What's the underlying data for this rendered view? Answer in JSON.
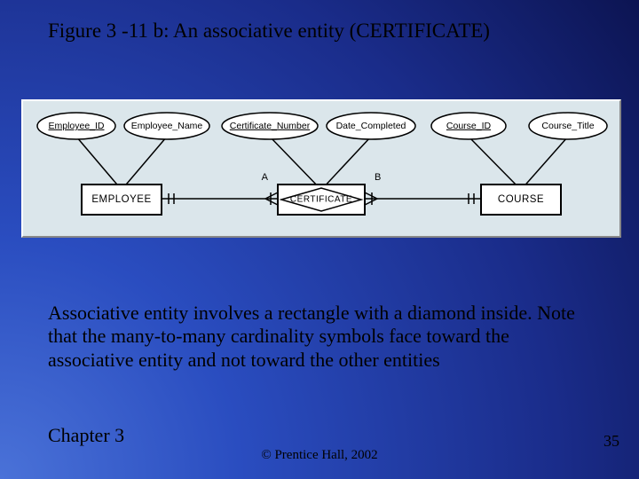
{
  "title": "Figure 3 -11 b: An associative entity (CERTIFICATE)",
  "caption": "Associative entity involves a rectangle with a diamond inside. Note that the many-to-many cardinality symbols face toward the associative entity and not toward the other entities",
  "footer_left": "Chapter 3",
  "footer_center": "© Prentice Hall, 2002",
  "footer_right": "35",
  "diagram": {
    "entities": {
      "employee": "EMPLOYEE",
      "certificate": "CERTIFICATE",
      "course": "COURSE"
    },
    "attributes": {
      "employee_id": "Employee_ID",
      "employee_name": "Employee_Name",
      "certificate_number": "Certificate_Number",
      "date_completed": "Date_Completed",
      "course_id": "Course_ID",
      "course_title": "Course_Title"
    },
    "rel_labels": {
      "a": "A",
      "b": "B"
    }
  }
}
